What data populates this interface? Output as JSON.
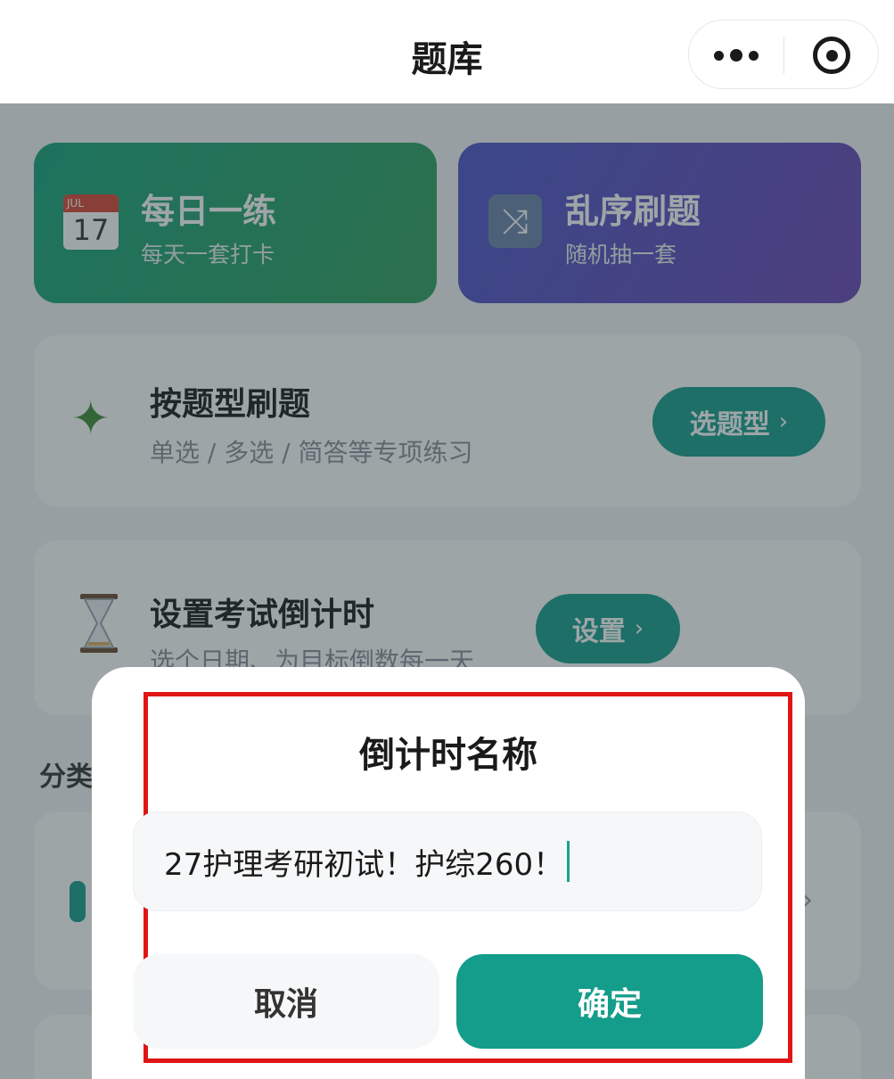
{
  "header": {
    "title": "题库",
    "more_icon": "more-dots-icon",
    "close_icon": "target-close-icon"
  },
  "cards": {
    "daily": {
      "title": "每日一练",
      "subtitle": "每天一套打卡",
      "icon_month": "JUL",
      "icon_day": "17",
      "icon": "calendar-icon",
      "color": "#16a37a"
    },
    "shuffle": {
      "title": "乱序刷题",
      "subtitle": "随机抽一套",
      "icon": "shuffle-icon",
      "color": "#4a55c9"
    }
  },
  "by_type": {
    "title": "按题型刷题",
    "subtitle": "单选 / 多选 / 简答等专项练习",
    "button_label": "选题型",
    "button_chevron": "›",
    "icon": "puzzle-icon"
  },
  "countdown": {
    "title": "设置考试倒计时",
    "subtitle": "选个日期、为目标倒数每一天",
    "button_label": "设置",
    "button_chevron": "›",
    "icon": "hourglass-icon"
  },
  "section": {
    "label": "分类"
  },
  "dialog": {
    "title": "倒计时名称",
    "input_value": "27护理考研初试！护综260！",
    "cancel_label": "取消",
    "confirm_label": "确定",
    "accent_color": "#149d8a",
    "highlight_color": "#e01515"
  }
}
